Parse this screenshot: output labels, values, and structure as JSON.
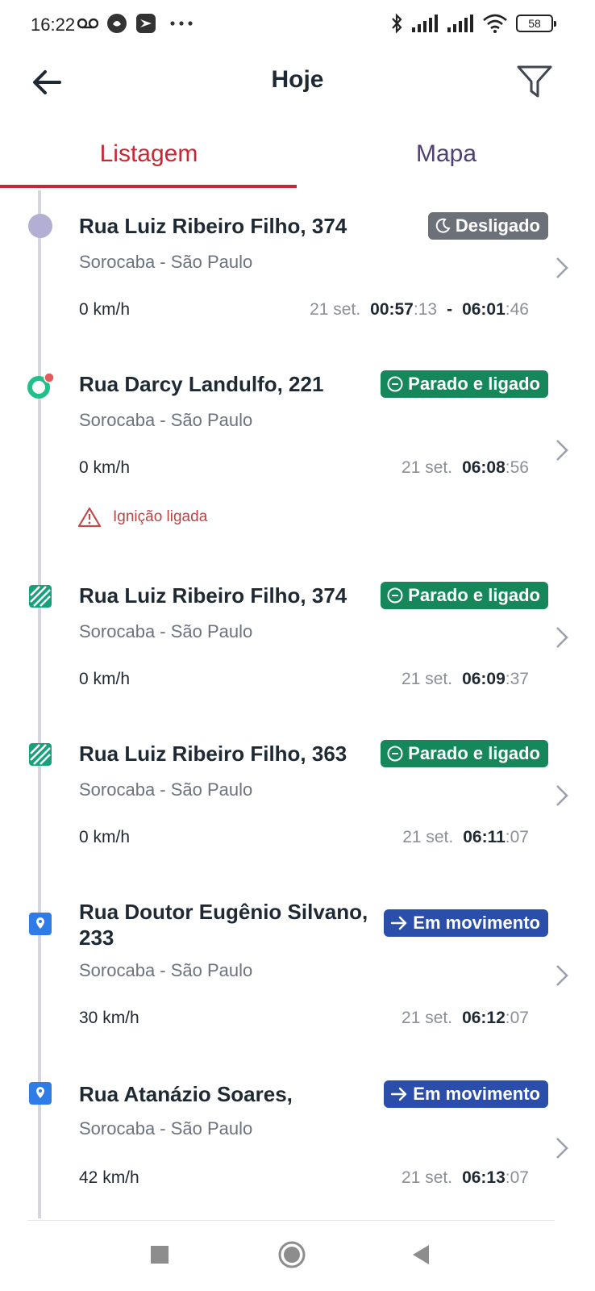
{
  "status_bar": {
    "time": "16:22",
    "left_icons": [
      "voicemail-icon",
      "notification-icon",
      "app-icon",
      "more-dots-icon"
    ],
    "right_icons": [
      "bluetooth-icon",
      "signal-icon",
      "signal-icon",
      "wifi-icon"
    ],
    "battery": "58"
  },
  "header": {
    "title": "Hoje",
    "back_icon": "back-arrow-icon",
    "filter_icon": "filter-icon"
  },
  "tabs": [
    {
      "label": "Listagem",
      "active": true
    },
    {
      "label": "Mapa",
      "active": false
    }
  ],
  "colors": {
    "accent": "#c62834",
    "tab_inactive": "#4f3f73",
    "badge_off": "#6b7079",
    "badge_idle": "#15875a",
    "badge_moving": "#2a4eaa",
    "alert": "#b64545"
  },
  "items": [
    {
      "street": "Rua Luiz Ribeiro Filho, 374",
      "city": "Sorocaba - São Paulo",
      "speed": "0 km/h",
      "badge": "Desligado",
      "badge_icon": "moon-icon",
      "marker": "off-circle-icon",
      "date": "21 set.",
      "time_start_hm": "00:57",
      "time_start_sec": ":13",
      "separator": "-",
      "time_end_hm": "06:01",
      "time_end_sec": ":46"
    },
    {
      "street": "Rua Darcy Landulfo, 221",
      "city": "Sorocaba - São Paulo",
      "speed": "0 km/h",
      "badge": "Parado e ligado",
      "badge_icon": "minus-circle-icon",
      "marker": "ring-alert-icon",
      "date": "21 set.",
      "time_hm": "06:08",
      "time_sec": ":56",
      "alert": "Ignição ligada",
      "alert_icon": "warning-triangle-icon"
    },
    {
      "street": "Rua Luiz Ribeiro Filho, 374",
      "city": "Sorocaba - São Paulo",
      "speed": "0 km/h",
      "badge": "Parado e ligado",
      "badge_icon": "minus-circle-icon",
      "marker": "striped-square-icon",
      "date": "21 set.",
      "time_hm": "06:09",
      "time_sec": ":37"
    },
    {
      "street": "Rua Luiz Ribeiro Filho, 363",
      "city": "Sorocaba - São Paulo",
      "speed": "0 km/h",
      "badge": "Parado e ligado",
      "badge_icon": "minus-circle-icon",
      "marker": "striped-square-icon",
      "date": "21 set.",
      "time_hm": "06:11",
      "time_sec": ":07"
    },
    {
      "street_line1": "Rua Doutor Eugênio Silvano,",
      "street_line2": "233",
      "city": "Sorocaba - São Paulo",
      "speed": "30 km/h",
      "badge": "Em movimento",
      "badge_icon": "arrow-right-icon",
      "marker": "location-pin-square-icon",
      "date": "21 set.",
      "time_hm": "06:12",
      "time_sec": ":07"
    },
    {
      "street": "Rua Atanázio Soares,",
      "city": "Sorocaba - São Paulo",
      "speed": "42 km/h",
      "badge": "Em movimento",
      "badge_icon": "arrow-right-icon",
      "marker": "location-pin-square-icon",
      "date": "21 set.",
      "time_hm": "06:13",
      "time_sec": ":07"
    }
  ],
  "nav_bar": [
    "recents-square-icon",
    "home-circle-icon",
    "back-triangle-icon"
  ]
}
